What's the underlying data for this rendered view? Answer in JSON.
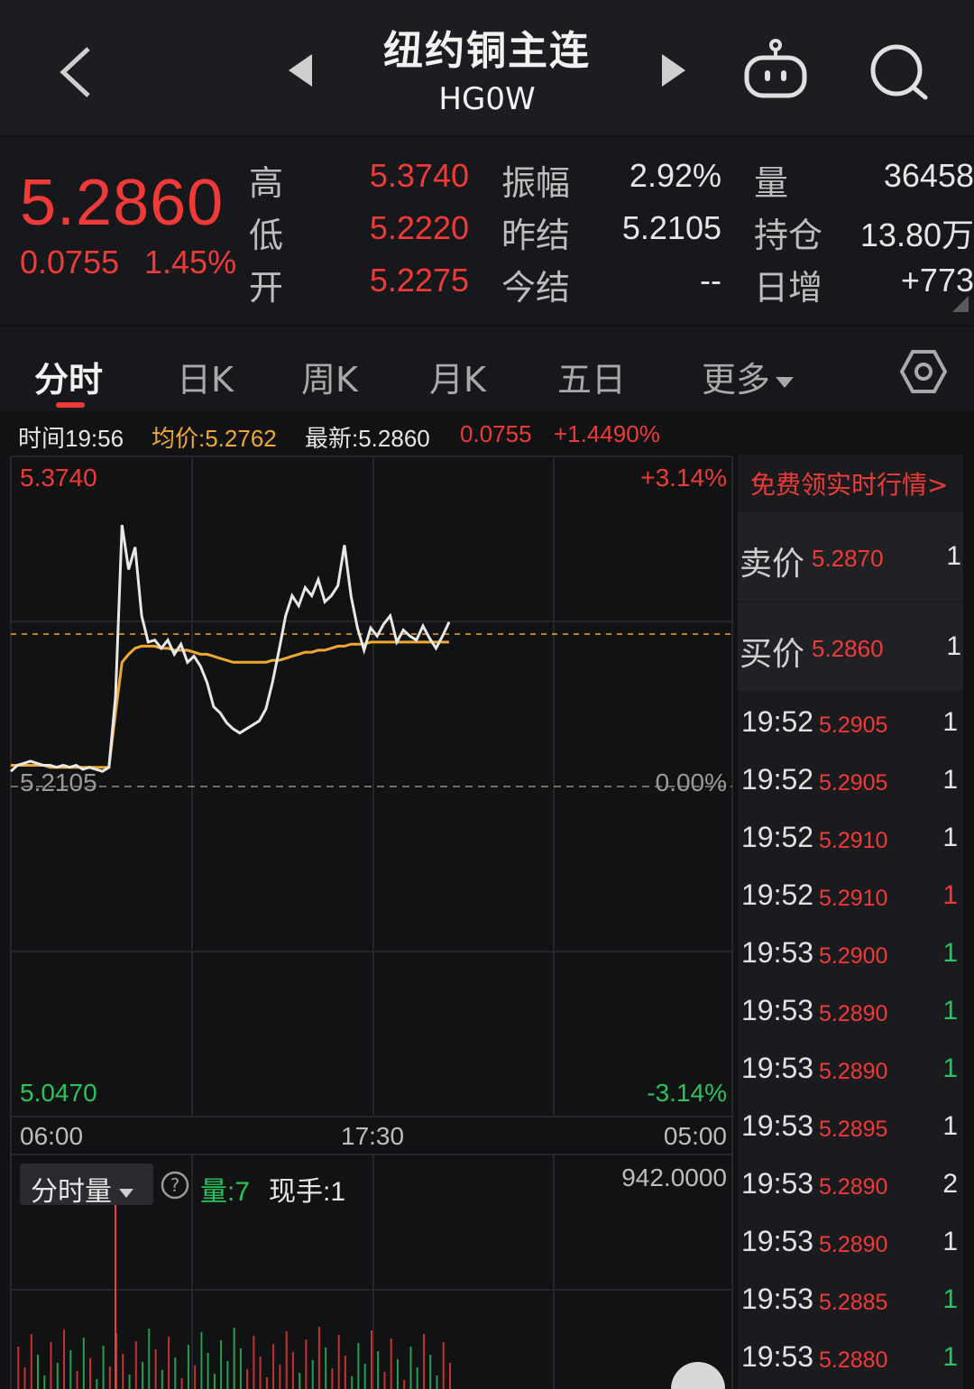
{
  "header": {
    "title": "纽约铜主连",
    "code": "HG0W"
  },
  "quote": {
    "price": "5.2860",
    "change": "0.0755",
    "change_pct": "1.45%",
    "labels": {
      "high": "高",
      "low": "低",
      "open": "开",
      "amplitude": "振幅",
      "prev_settle": "昨结",
      "settle": "今结",
      "volume": "量",
      "open_interest": "持仓",
      "daily_inc": "日增"
    },
    "values": {
      "high": "5.3740",
      "low": "5.2220",
      "open": "5.2275",
      "amplitude": "2.92%",
      "prev_settle": "5.2105",
      "settle": "--",
      "volume": "36458",
      "open_interest": "13.80万",
      "daily_inc": "+773"
    }
  },
  "tabs": [
    "分时",
    "日K",
    "周K",
    "月K",
    "五日",
    "更多"
  ],
  "info": {
    "time": "时间19:56",
    "avg": "均价:5.2762",
    "latest": "最新:5.2860",
    "change": "0.0755",
    "change_pct": "+1.4490%"
  },
  "chart_data": {
    "type": "line",
    "title": "",
    "y_top": "5.3740",
    "y_mid": "5.2105",
    "y_bottom": "5.0470",
    "pct_top": "+3.14%",
    "pct_mid": "0.00%",
    "pct_bottom": "-3.14%",
    "x_labels": [
      "06:00",
      "17:30",
      "05:00"
    ],
    "ylim": [
      5.047,
      5.374
    ],
    "prev_settle": 5.2105,
    "latest": 5.286,
    "series": [
      {
        "values": [
          5.218,
          5.221,
          5.222,
          5.223,
          5.222,
          5.221,
          5.221,
          5.22,
          5.221,
          5.22,
          5.221,
          5.219,
          5.22,
          5.219,
          5.218,
          5.22,
          5.255,
          5.34,
          5.318,
          5.329,
          5.295,
          5.282,
          5.283,
          5.279,
          5.283,
          5.276,
          5.281,
          5.272,
          5.275,
          5.27,
          5.262,
          5.25,
          5.247,
          5.242,
          5.239,
          5.237,
          5.239,
          5.241,
          5.243,
          5.249,
          5.262,
          5.278,
          5.295,
          5.305,
          5.3,
          5.309,
          5.305,
          5.313,
          5.302,
          5.305,
          5.31,
          5.33,
          5.305,
          5.289,
          5.278,
          5.289,
          5.285,
          5.291,
          5.295,
          5.282,
          5.288,
          5.285,
          5.283,
          5.29,
          5.284,
          5.279,
          5.285,
          5.292
        ],
        "color": "#e8e8e8"
      },
      {
        "values": [
          5.221,
          5.221,
          5.221,
          5.221,
          5.221,
          5.221,
          5.22,
          5.22,
          5.22,
          5.22,
          5.22,
          5.22,
          5.22,
          5.22,
          5.22,
          5.22,
          5.247,
          5.272,
          5.276,
          5.279,
          5.28,
          5.28,
          5.28,
          5.279,
          5.279,
          5.278,
          5.278,
          5.278,
          5.277,
          5.276,
          5.276,
          5.275,
          5.274,
          5.273,
          5.272,
          5.272,
          5.272,
          5.272,
          5.272,
          5.272,
          5.273,
          5.273,
          5.274,
          5.275,
          5.276,
          5.277,
          5.277,
          5.278,
          5.278,
          5.279,
          5.28,
          5.28,
          5.281,
          5.281,
          5.281,
          5.282,
          5.282,
          5.282,
          5.282,
          5.282,
          5.282,
          5.282,
          5.282,
          5.282,
          5.282,
          5.282,
          5.282,
          5.282
        ],
        "color": "#f0a830"
      }
    ]
  },
  "volume": {
    "selector": "分时量",
    "vol_label": "量:7",
    "hand_label": "现手:1",
    "max": "942.0000"
  },
  "side": {
    "promo": "免费领实时行情>",
    "sell": {
      "label": "卖价",
      "price": "5.2870",
      "qty": "1"
    },
    "buy": {
      "label": "买价",
      "price": "5.2860",
      "qty": "1"
    },
    "ticks": [
      {
        "time": "19:52",
        "price": "5.2905",
        "qty": "1",
        "dir": "n"
      },
      {
        "time": "19:52",
        "price": "5.2905",
        "qty": "1",
        "dir": "n"
      },
      {
        "time": "19:52",
        "price": "5.2910",
        "qty": "1",
        "dir": "n"
      },
      {
        "time": "19:52",
        "price": "5.2910",
        "qty": "1",
        "dir": "up"
      },
      {
        "time": "19:53",
        "price": "5.2900",
        "qty": "1",
        "dir": "down"
      },
      {
        "time": "19:53",
        "price": "5.2890",
        "qty": "1",
        "dir": "down"
      },
      {
        "time": "19:53",
        "price": "5.2890",
        "qty": "1",
        "dir": "down"
      },
      {
        "time": "19:53",
        "price": "5.2895",
        "qty": "1",
        "dir": "n"
      },
      {
        "time": "19:53",
        "price": "5.2890",
        "qty": "2",
        "dir": "n"
      },
      {
        "time": "19:53",
        "price": "5.2890",
        "qty": "1",
        "dir": "n"
      },
      {
        "time": "19:53",
        "price": "5.2885",
        "qty": "1",
        "dir": "down"
      },
      {
        "time": "19:53",
        "price": "5.2880",
        "qty": "1",
        "dir": "down"
      }
    ]
  },
  "colors": {
    "up": "#f03a37",
    "down": "#28c35b",
    "avg": "#f0a830",
    "price_line": "#e8e8e8"
  }
}
